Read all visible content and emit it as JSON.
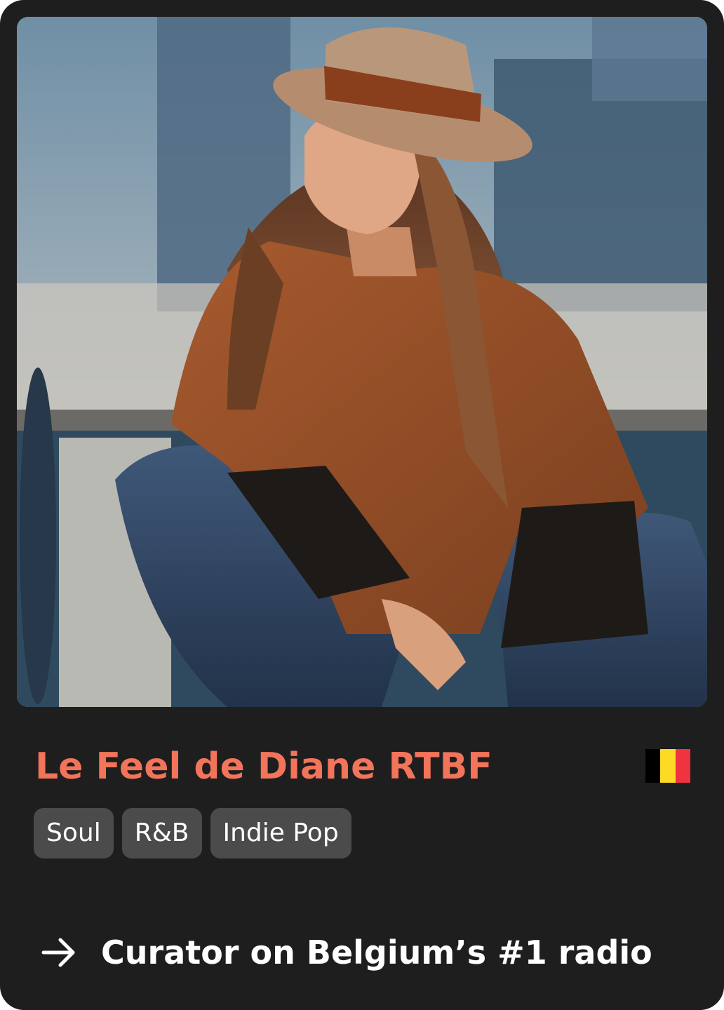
{
  "curator": {
    "name": "Le Feel de Diane RTBF",
    "photo_icon": "curator-portrait",
    "country_flag_icon": "belgium-flag-icon",
    "flag_colors": [
      "#000000",
      "#fdda24",
      "#ef3340"
    ]
  },
  "genres": [
    "Soul",
    "R&B",
    "Indie Pop"
  ],
  "headline": {
    "icon": "arrow-right-icon",
    "text": "Curator on Belgium’s #1 radio"
  },
  "colors": {
    "card_background": "#1e1e1e",
    "name_accent": "#f2745a",
    "tag_background": "#4b4b4b",
    "text": "#ffffff"
  }
}
